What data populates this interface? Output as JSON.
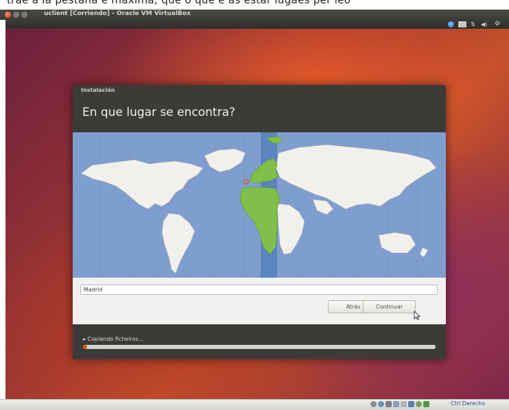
{
  "caption": {
    "text": "trae a la pestana e maxima; que o que e as estar lugaes per leo"
  },
  "vbox": {
    "title": "uclient [Corriendo] - Oracle VM VirtualBox"
  },
  "panel": {
    "icons": [
      "accessibility-icon",
      "keyboard-icon",
      "network-icon",
      "volume-icon",
      "gear-icon"
    ]
  },
  "installer": {
    "window_label": "Instalación",
    "heading": "En que lugar se encontra?",
    "city_value": "Madrid",
    "back_label": "Atrás",
    "continue_label": "Continuar",
    "progress_label": "▸ Copiando ficheiros...",
    "progress_fraction": 0.01,
    "map_colors": {
      "ocean": "#7f9ed0",
      "land": "#f1f0ec",
      "selected_land": "#7fbf4a",
      "timezone_band": "#5c84bf"
    }
  },
  "statusbar": {
    "host_key_label": "Ctrl Derecho"
  }
}
